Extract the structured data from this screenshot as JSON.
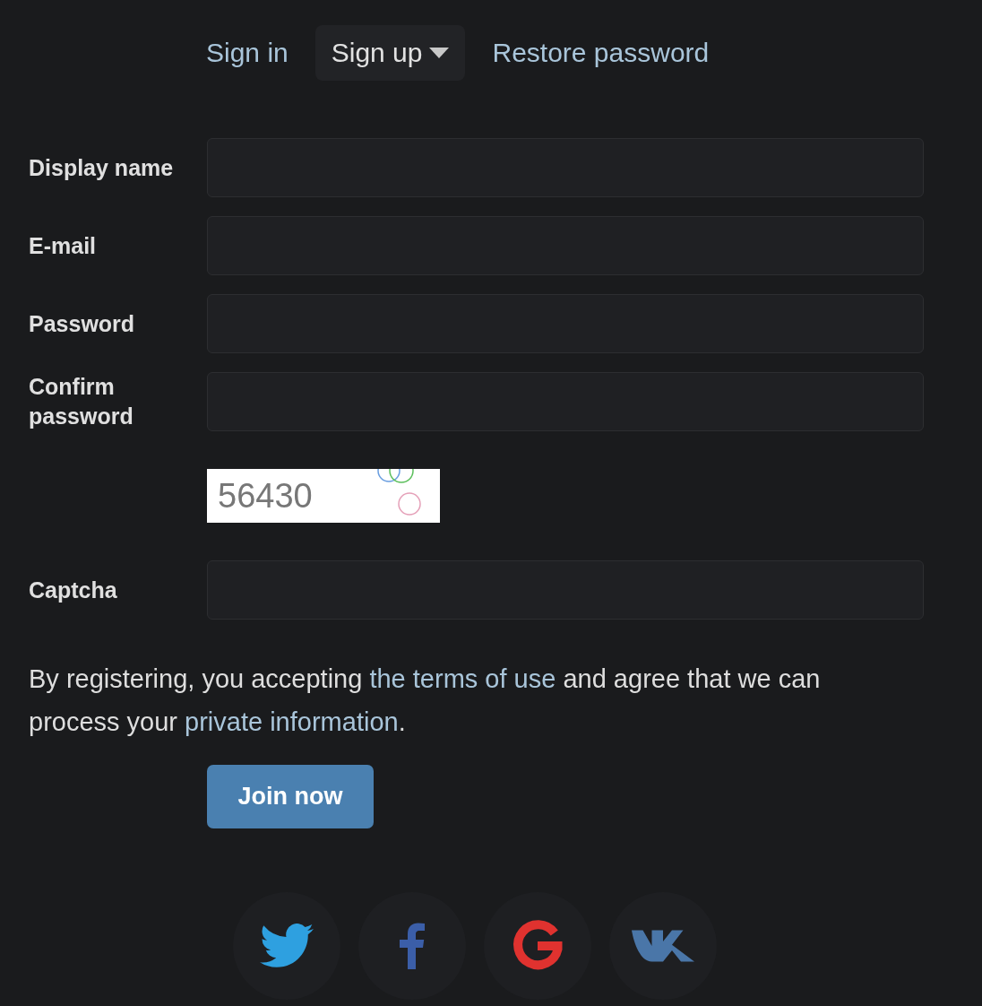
{
  "tabs": [
    {
      "label": "Sign in",
      "selected": false,
      "dropdown": false
    },
    {
      "label": "Sign up",
      "selected": true,
      "dropdown": true
    },
    {
      "label": "Restore password",
      "selected": false,
      "dropdown": false
    }
  ],
  "fields": [
    {
      "kind": "input",
      "label": "Display name"
    },
    {
      "kind": "input",
      "label": "E-mail"
    },
    {
      "kind": "input",
      "label": "Password"
    },
    {
      "kind": "input",
      "label": "Confirm password"
    },
    {
      "kind": "captcha-image",
      "code": "56430"
    },
    {
      "kind": "input",
      "label": "Captcha"
    }
  ],
  "notice": [
    {
      "kind": "text",
      "text": "By registering, you accepting "
    },
    {
      "kind": "link",
      "text": "the terms of use"
    },
    {
      "kind": "text",
      "text": " and agree that we can process your "
    },
    {
      "kind": "link",
      "text": "private information"
    },
    {
      "kind": "text",
      "text": "."
    }
  ],
  "submit": {
    "label": "Join now"
  },
  "social": [
    {
      "kind": "twitter"
    },
    {
      "kind": "facebook"
    },
    {
      "kind": "google"
    },
    {
      "kind": "vk"
    }
  ]
}
